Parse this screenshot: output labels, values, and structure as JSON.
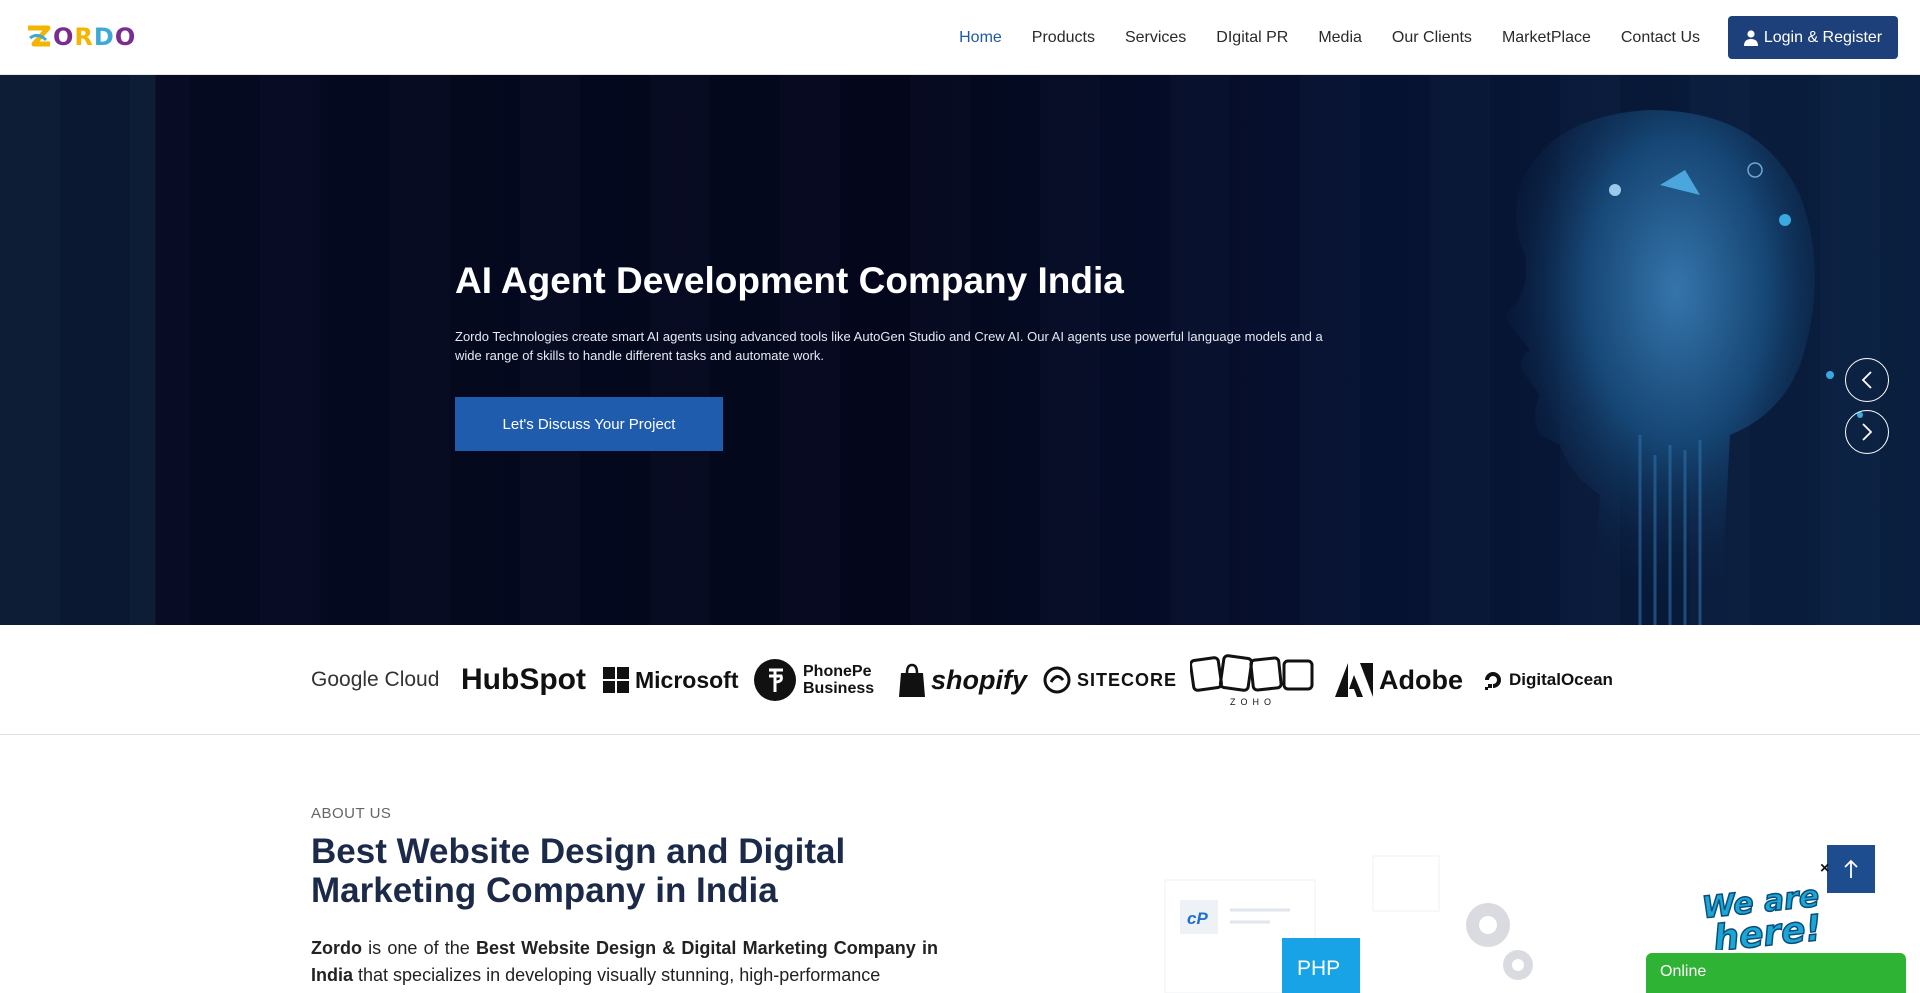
{
  "brand": {
    "logo_text": [
      "Z",
      "O",
      "R",
      "D",
      "O"
    ],
    "logo_colors": [
      "#f4b400",
      "#7b2d8e",
      "#f4b400",
      "#3da9d8",
      "#7b2d8e"
    ]
  },
  "nav": {
    "items": [
      {
        "label": "Home",
        "active": true
      },
      {
        "label": "Products"
      },
      {
        "label": "Services"
      },
      {
        "label": "DIgital PR"
      },
      {
        "label": "Media"
      },
      {
        "label": "Our Clients"
      },
      {
        "label": "MarketPlace"
      },
      {
        "label": "Contact Us"
      }
    ],
    "login_label": "Login & Register"
  },
  "hero": {
    "title": "AI Agent Development Company India",
    "description": "Zordo Technologies create smart AI agents using advanced tools like AutoGen Studio and Crew AI. Our AI agents use powerful language models and a wide range of skills to handle different tasks and automate work.",
    "cta_label": "Let's Discuss Your Project"
  },
  "partners": [
    "Google Cloud",
    "HubSpot",
    "Microsoft",
    "PhonePe Business",
    "shopify",
    "SITECORE",
    "ZOHO",
    "Adobe",
    "DigitalOcean"
  ],
  "about": {
    "label": "ABOUT US",
    "title": "Best Website Design and Digital Marketing Company in India",
    "text_brand": "Zordo",
    "text_1": " is one of the ",
    "text_bold": "Best Website Design & Digital Marketing Company in India",
    "text_2": " that specializes in developing visually stunning, high-performance"
  },
  "illustration": {
    "php_label": "PHP",
    "cp_label": "cP"
  },
  "chat": {
    "status": "Online",
    "close_label": "×"
  },
  "colors": {
    "primary": "#1d3f7a",
    "accent_blue": "#1f5cad",
    "online_green": "#2fb334"
  }
}
